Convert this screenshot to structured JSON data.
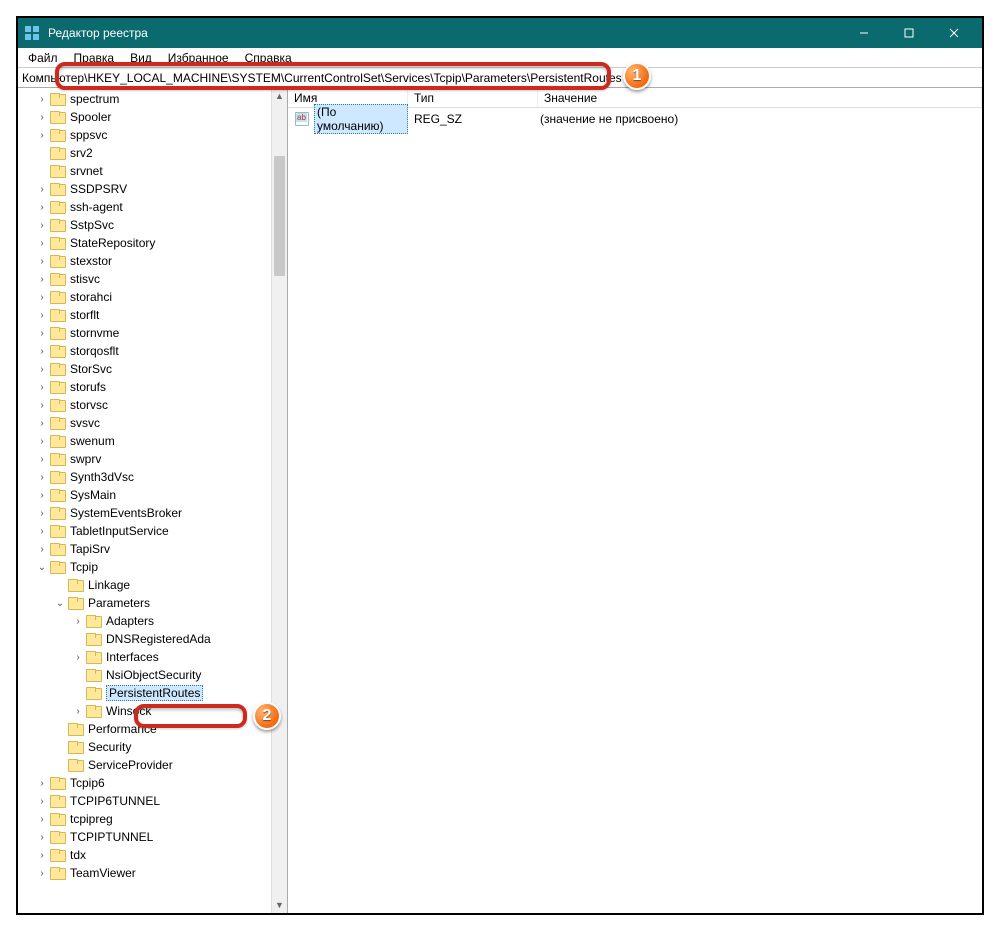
{
  "window": {
    "title": "Редактор реестра"
  },
  "menu": {
    "file": "Файл",
    "edit": "Правка",
    "view": "Вид",
    "favorites": "Избранное",
    "help": "Справка"
  },
  "address": {
    "label": "Компьютер",
    "path": "\\HKEY_LOCAL_MACHINE\\SYSTEM\\CurrentControlSet\\Services\\Tcpip\\Parameters\\PersistentRoutes"
  },
  "list": {
    "columns": {
      "name": "Имя",
      "type": "Тип",
      "value": "Значение"
    },
    "rows": [
      {
        "name": "(По умолчанию)",
        "type": "REG_SZ",
        "value": "(значение не присвоено)"
      }
    ]
  },
  "tree": [
    {
      "d": 5,
      "e": ">",
      "t": "spectrum"
    },
    {
      "d": 5,
      "e": ">",
      "t": "Spooler"
    },
    {
      "d": 5,
      "e": ">",
      "t": "sppsvc"
    },
    {
      "d": 5,
      "e": "",
      "t": "srv2"
    },
    {
      "d": 5,
      "e": "",
      "t": "srvnet"
    },
    {
      "d": 5,
      "e": ">",
      "t": "SSDPSRV"
    },
    {
      "d": 5,
      "e": ">",
      "t": "ssh-agent"
    },
    {
      "d": 5,
      "e": ">",
      "t": "SstpSvc"
    },
    {
      "d": 5,
      "e": ">",
      "t": "StateRepository"
    },
    {
      "d": 5,
      "e": ">",
      "t": "stexstor"
    },
    {
      "d": 5,
      "e": ">",
      "t": "stisvc"
    },
    {
      "d": 5,
      "e": ">",
      "t": "storahci"
    },
    {
      "d": 5,
      "e": ">",
      "t": "storflt"
    },
    {
      "d": 5,
      "e": ">",
      "t": "stornvme"
    },
    {
      "d": 5,
      "e": ">",
      "t": "storqosflt"
    },
    {
      "d": 5,
      "e": ">",
      "t": "StorSvc"
    },
    {
      "d": 5,
      "e": ">",
      "t": "storufs"
    },
    {
      "d": 5,
      "e": ">",
      "t": "storvsc"
    },
    {
      "d": 5,
      "e": ">",
      "t": "svsvc"
    },
    {
      "d": 5,
      "e": ">",
      "t": "swenum"
    },
    {
      "d": 5,
      "e": ">",
      "t": "swprv"
    },
    {
      "d": 5,
      "e": ">",
      "t": "Synth3dVsc"
    },
    {
      "d": 5,
      "e": ">",
      "t": "SysMain"
    },
    {
      "d": 5,
      "e": ">",
      "t": "SystemEventsBroker"
    },
    {
      "d": 5,
      "e": ">",
      "t": "TabletInputService"
    },
    {
      "d": 5,
      "e": ">",
      "t": "TapiSrv"
    },
    {
      "d": 5,
      "e": "v",
      "t": "Tcpip"
    },
    {
      "d": 6,
      "e": "",
      "t": "Linkage"
    },
    {
      "d": 6,
      "e": "v",
      "t": "Parameters"
    },
    {
      "d": 7,
      "e": ">",
      "t": "Adapters"
    },
    {
      "d": 7,
      "e": "",
      "t": "DNSRegisteredAda"
    },
    {
      "d": 7,
      "e": ">",
      "t": "Interfaces"
    },
    {
      "d": 7,
      "e": "",
      "t": "NsiObjectSecurity"
    },
    {
      "d": 7,
      "e": "",
      "t": "PersistentRoutes",
      "sel": true
    },
    {
      "d": 7,
      "e": ">",
      "t": "Winsock"
    },
    {
      "d": 6,
      "e": "",
      "t": "Performance"
    },
    {
      "d": 6,
      "e": "",
      "t": "Security"
    },
    {
      "d": 6,
      "e": "",
      "t": "ServiceProvider"
    },
    {
      "d": 5,
      "e": ">",
      "t": "Tcpip6"
    },
    {
      "d": 5,
      "e": ">",
      "t": "TCPIP6TUNNEL"
    },
    {
      "d": 5,
      "e": ">",
      "t": "tcpipreg"
    },
    {
      "d": 5,
      "e": ">",
      "t": "TCPIPTUNNEL"
    },
    {
      "d": 5,
      "e": ">",
      "t": "tdx"
    },
    {
      "d": 5,
      "e": ">",
      "t": "TeamViewer"
    }
  ],
  "badges": {
    "one": "1",
    "two": "2"
  }
}
